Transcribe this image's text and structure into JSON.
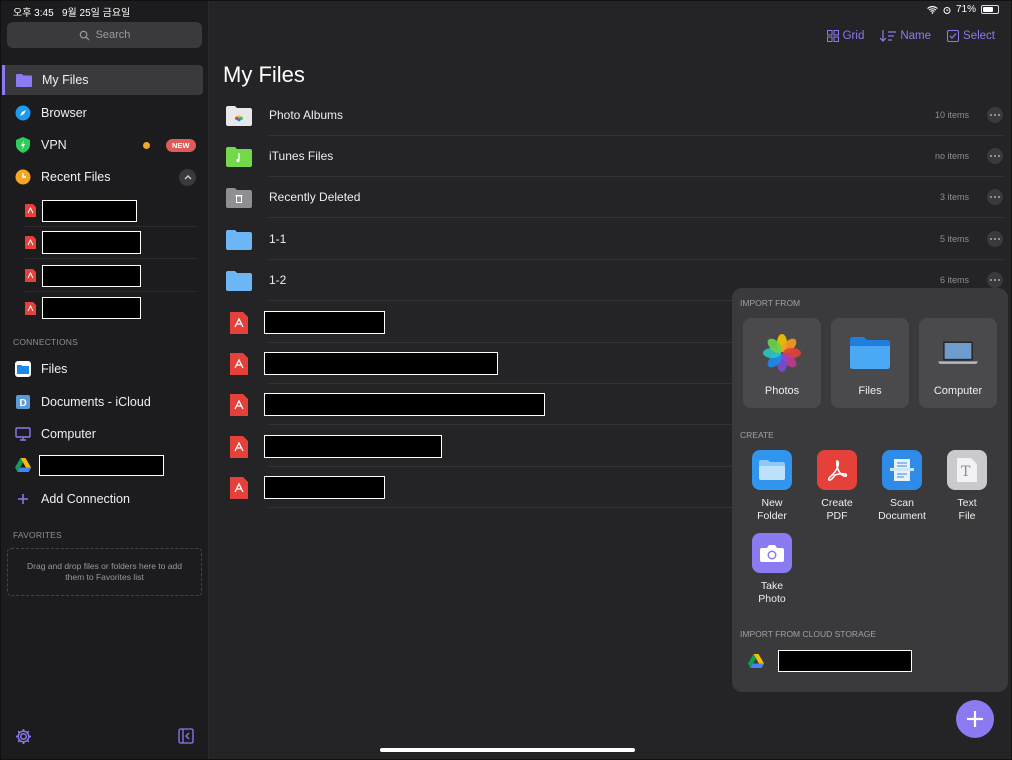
{
  "status": {
    "time": "오후 3:45",
    "date": "9월 25일 금요일",
    "battery": "71%",
    "battery_fraction": 0.71
  },
  "sidebar": {
    "search_placeholder": "Search",
    "items": [
      {
        "label": "My Files",
        "icon": "folder-icon"
      },
      {
        "label": "Browser",
        "icon": "compass-icon"
      },
      {
        "label": "VPN",
        "icon": "shield-icon",
        "badge": "NEW"
      },
      {
        "label": "Recent Files",
        "icon": "clock-icon"
      }
    ],
    "connections_label": "CONNECTIONS",
    "connections": [
      {
        "label": "Files",
        "icon": "files-app-icon"
      },
      {
        "label": "Documents - iCloud",
        "icon": "documents-icon"
      },
      {
        "label": "Computer",
        "icon": "computer-icon"
      },
      {
        "label": "",
        "icon": "google-drive-icon"
      },
      {
        "label": "Add Connection",
        "icon": "plus-icon"
      }
    ],
    "favorites_label": "FAVORITES",
    "favorites_hint": "Drag and drop files or folders here to add them to Favorites list"
  },
  "toolbar": {
    "grid": "Grid",
    "sort": "Name",
    "select": "Select"
  },
  "main": {
    "title": "My Files",
    "rows": [
      {
        "name": "Photo Albums",
        "count": "10 items",
        "icon": "photo-albums-folder-icon"
      },
      {
        "name": "iTunes Files",
        "count": "no items",
        "icon": "itunes-folder-icon"
      },
      {
        "name": "Recently Deleted",
        "count": "3 items",
        "icon": "trash-folder-icon"
      },
      {
        "name": "1-1",
        "count": "5 items",
        "icon": "folder-icon"
      },
      {
        "name": "1-2",
        "count": "6 items",
        "icon": "folder-icon"
      }
    ]
  },
  "popover": {
    "import_label": "IMPORT FROM",
    "imports": [
      {
        "label": "Photos",
        "icon": "photos-icon"
      },
      {
        "label": "Files",
        "icon": "files-folder-icon"
      },
      {
        "label": "Computer",
        "icon": "laptop-icon"
      }
    ],
    "create_label": "CREATE",
    "create": [
      {
        "label": "New\nFolder",
        "icon": "new-folder-icon"
      },
      {
        "label": "Create\nPDF",
        "icon": "pdf-icon"
      },
      {
        "label": "Scan\nDocument",
        "icon": "scan-icon"
      },
      {
        "label": "Text\nFile",
        "icon": "text-file-icon"
      },
      {
        "label": "Take\nPhoto",
        "icon": "camera-icon"
      }
    ],
    "cloud_label": "IMPORT FROM CLOUD STORAGE"
  },
  "colors": {
    "accent": "#8a7cf0",
    "background": "#242426",
    "sidebar": "#1c1c1e"
  }
}
